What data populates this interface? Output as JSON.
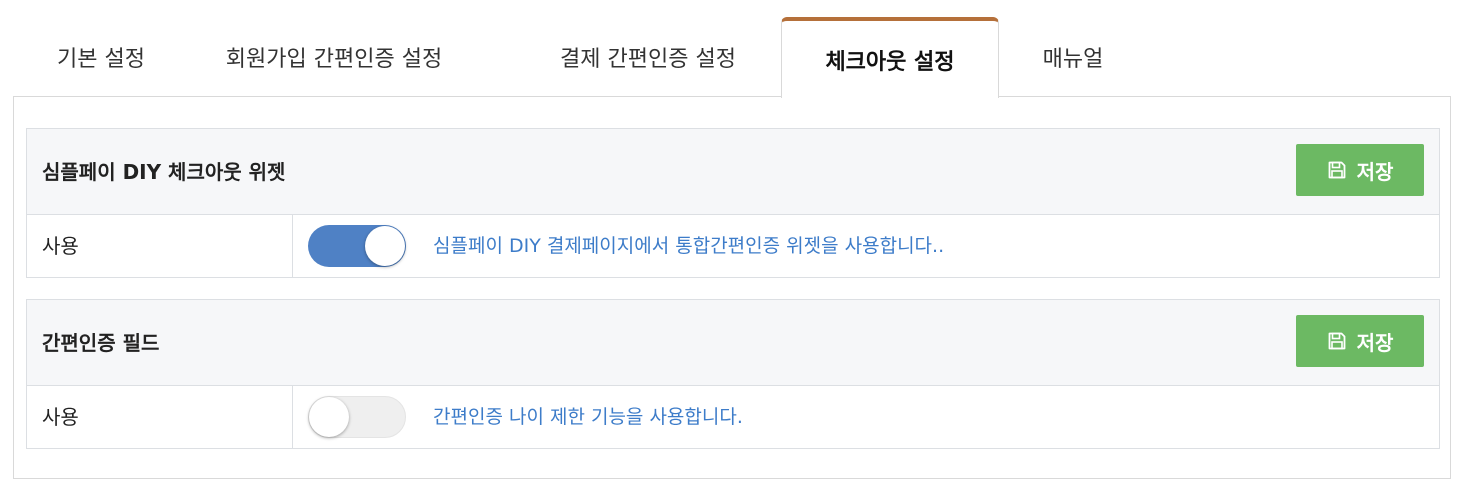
{
  "tabs": [
    {
      "label": "기본 설정"
    },
    {
      "label": "회원가입 간편인증 설정"
    },
    {
      "label": "결제 간편인증 설정"
    },
    {
      "label": "체크아웃 설정"
    },
    {
      "label": "매뉴얼"
    }
  ],
  "active_tab": "체크아웃 설정",
  "sections": [
    {
      "title": "심플페이 DIY 체크아웃 위젯",
      "save_label": "저장",
      "row_label": "사용",
      "toggle_on": true,
      "description": "심플페이 DIY 결제페이지에서 통합간편인증 위젯을 사용합니다.."
    },
    {
      "title": "간편인증 필드",
      "save_label": "저장",
      "row_label": "사용",
      "toggle_on": false,
      "description": "간편인증 나이 제한 기능을 사용합니다."
    }
  ],
  "colors": {
    "active_tab_accent": "#b5703a",
    "save_button": "#6cb963",
    "toggle_on": "#4f81c5",
    "description_text": "#3d7cc9"
  },
  "icons": {
    "save": "floppy-disk-icon"
  }
}
